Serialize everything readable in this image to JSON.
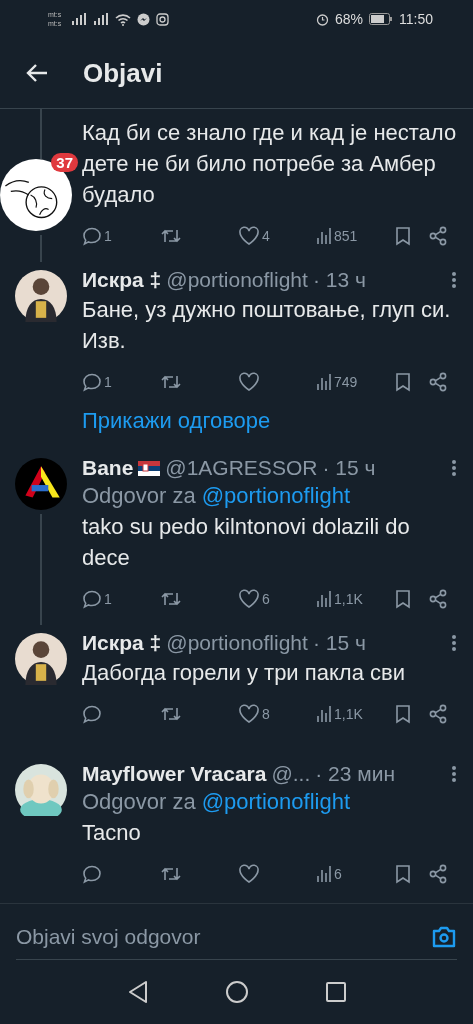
{
  "status_bar": {
    "carrier_top": "mt:s",
    "carrier_bottom": "mt:s",
    "battery": "68%",
    "time": "11:50"
  },
  "header": {
    "title": "Objavi"
  },
  "tweets": [
    {
      "avatar": {
        "kind": "globe"
      },
      "badge": "37",
      "text": "Кад би се знало где и кад је нестало дете не би било потребе за Амбер будало",
      "reply_count": "1",
      "likes": "4",
      "views": "851",
      "line_above": true,
      "line_below": true
    },
    {
      "avatar": {
        "kind": "person"
      },
      "name": "Искра ‡",
      "handle": "@portionoflight",
      "time": "· 13 ч",
      "text": "Бане, уз дужно поштовање, глуп си. Изв.",
      "reply_count": "1",
      "views": "749",
      "line_above": false,
      "line_below": false,
      "show_replies": "Прикажи одговоре"
    },
    {
      "avatar": {
        "kind": "logo"
      },
      "name": "Bane",
      "flag": true,
      "handle": "@1AGRESSOR",
      "time": "· 15 ч",
      "reply_prefix": "Odgovor za",
      "reply_to": "@portionoflight",
      "text": "tako su pedo kilntonovi dolazili do dece",
      "reply_count": "1",
      "likes": "6",
      "views": "1,1K",
      "line_above": false,
      "line_below": true
    },
    {
      "avatar": {
        "kind": "person"
      },
      "name": "Искра ‡",
      "handle": "@portionoflight",
      "time": "· 15 ч",
      "text": "Дабогда горели у три пакла сви",
      "likes": "8",
      "views": "1,1K",
      "line_above": false,
      "line_below": false
    },
    {
      "avatar": {
        "kind": "dog"
      },
      "name": "Mayflower Vracara",
      "handle": "@...",
      "time": "· 23 мин",
      "reply_prefix": "Odgovor za",
      "reply_to": "@portionoflight",
      "text": "Tacno",
      "views": "6",
      "line_above": false,
      "line_below": false
    }
  ],
  "reply_bar": {
    "placeholder": "Objavi svoj odgovor"
  }
}
